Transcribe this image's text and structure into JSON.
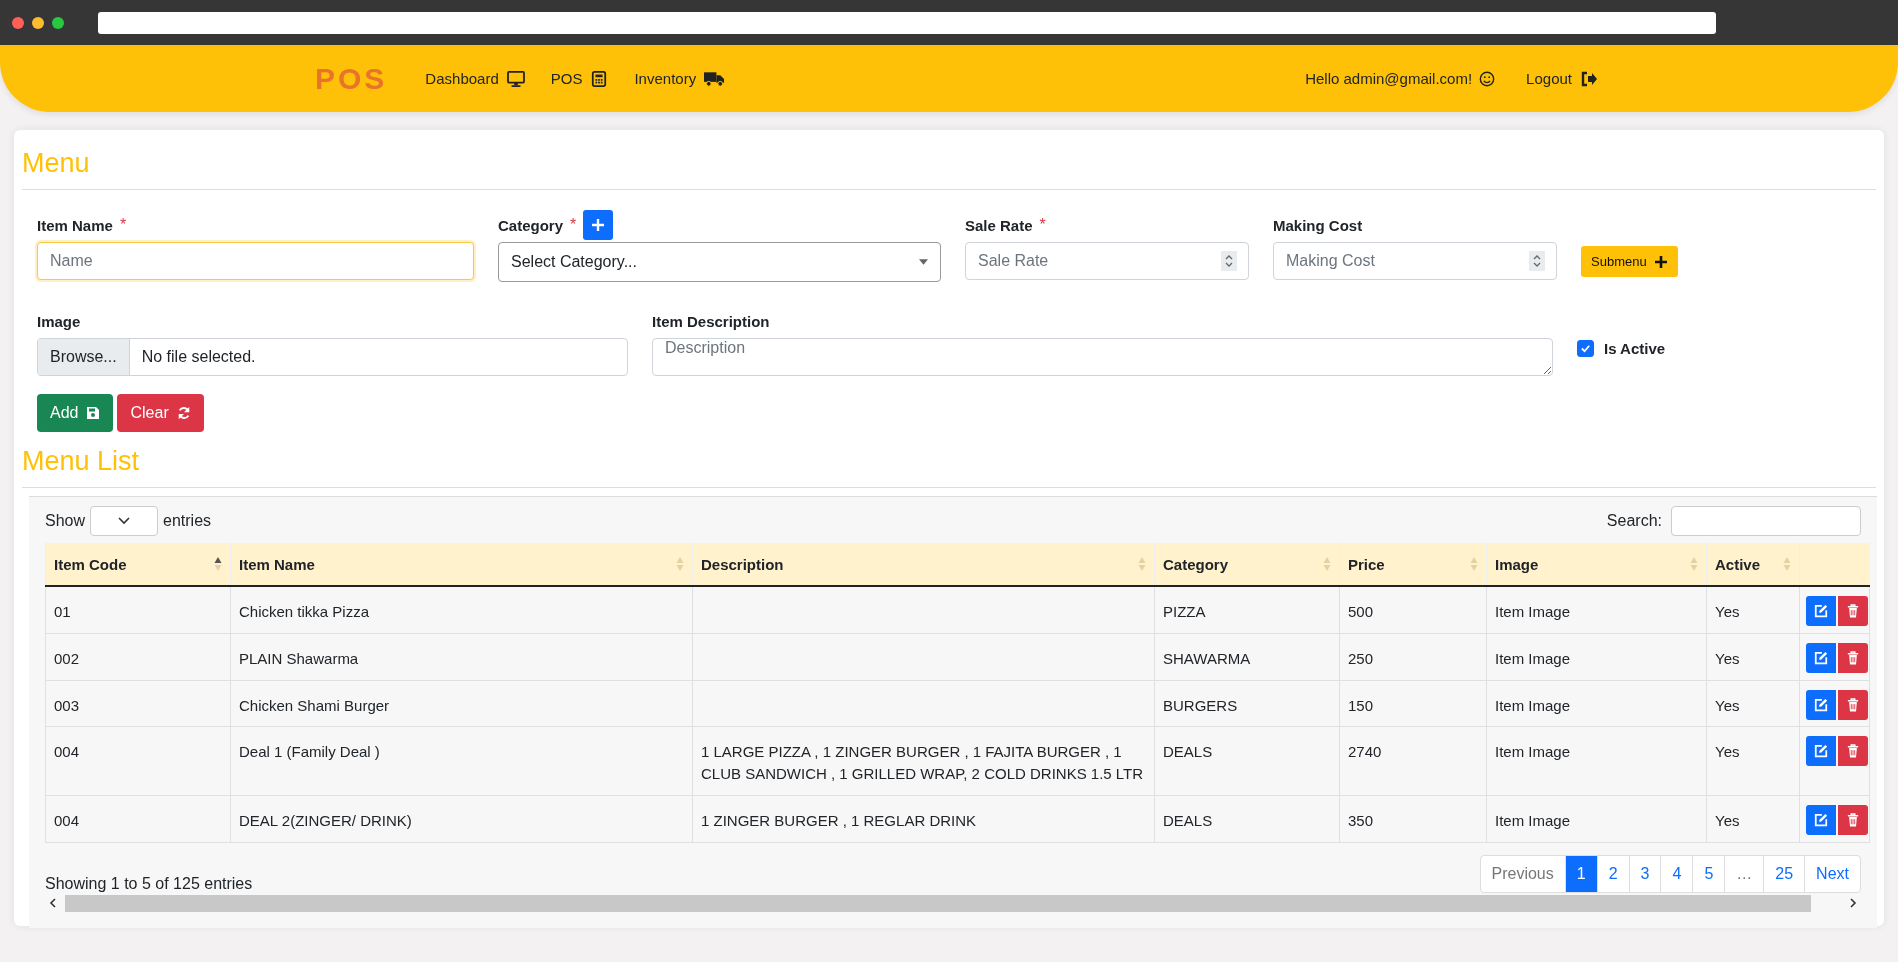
{
  "header": {
    "logo": "POS",
    "links": [
      {
        "label": "Dashboard"
      },
      {
        "label": "POS"
      },
      {
        "label": "Inventory"
      }
    ],
    "greeting": "Hello admin@gmail.com!",
    "logout": "Logout"
  },
  "form": {
    "title": "Menu",
    "rows": [
      {
        "fields": [
          {
            "kind": "text",
            "label": "Item Name",
            "required_mark": "*",
            "placeholder": "Name",
            "focused": true
          },
          {
            "kind": "select",
            "label": "Category",
            "required_mark": "*",
            "value": "Select Category...",
            "add_button": true
          },
          {
            "kind": "number",
            "label": "Sale Rate",
            "required_mark": "*",
            "placeholder": "Sale Rate"
          },
          {
            "kind": "number",
            "label": "Making Cost",
            "placeholder": "Making Cost"
          },
          {
            "kind": "button",
            "label": "Submenu"
          }
        ]
      },
      {
        "fields": [
          {
            "kind": "file",
            "label": "Image",
            "button": "Browse...",
            "value": "No file selected."
          },
          {
            "kind": "textarea",
            "label": "Item Description",
            "placeholder": "Description"
          },
          {
            "kind": "checkbox",
            "label": "Is Active",
            "checked": true
          }
        ]
      }
    ],
    "buttons": [
      {
        "label": "Add",
        "kind": "success"
      },
      {
        "label": "Clear",
        "kind": "danger"
      }
    ]
  },
  "list": {
    "title": "Menu List",
    "show_label": "Show",
    "entries_label": "entries",
    "search_label": "Search:",
    "columns": [
      {
        "label": "Item Code",
        "sorted": true
      },
      {
        "label": "Item Name",
        "sorted": false
      },
      {
        "label": "Description",
        "sorted": false
      },
      {
        "label": "Category",
        "sorted": false
      },
      {
        "label": "Price",
        "sorted": false
      },
      {
        "label": "Image",
        "sorted": false
      },
      {
        "label": "Active",
        "sorted": false
      }
    ],
    "rows": [
      {
        "cells": [
          "01",
          "Chicken tikka Pizza",
          null,
          "PIZZA",
          "500",
          "Item Image",
          "Yes"
        ]
      },
      {
        "cells": [
          "002",
          "PLAIN Shawarma",
          null,
          "SHAWARMA",
          "250",
          "Item Image",
          "Yes"
        ]
      },
      {
        "cells": [
          "003",
          "Chicken Shami Burger",
          null,
          "BURGERS",
          "150",
          "Item Image",
          "Yes"
        ]
      },
      {
        "cells": [
          "004",
          "Deal 1 (Family Deal )",
          "1 LARGE PIZZA , 1 ZINGER BURGER , 1 FAJITA BURGER , 1 CLUB SANDWICH , 1 GRILLED WRAP, 2 COLD DRINKS 1.5 LTR",
          "DEALS",
          "2740",
          "Item Image",
          "Yes"
        ]
      },
      {
        "cells": [
          "004",
          "DEAL 2(ZINGER/ DRINK)",
          "1 ZINGER BURGER , 1 REGLAR DRINK",
          "DEALS",
          "350",
          "Item Image",
          "Yes"
        ]
      }
    ],
    "info": "Showing 1 to 5 of 125 entries",
    "pages": [
      {
        "label": "Previous",
        "selected": false,
        "disabled": true
      },
      {
        "label": "1",
        "selected": true,
        "disabled": false
      },
      {
        "label": "2",
        "selected": false,
        "disabled": false
      },
      {
        "label": "3",
        "selected": false,
        "disabled": false
      },
      {
        "label": "4",
        "selected": false,
        "disabled": false
      },
      {
        "label": "5",
        "selected": false,
        "disabled": false
      },
      {
        "label": "…",
        "selected": false,
        "disabled": true
      },
      {
        "label": "25",
        "selected": false,
        "disabled": false
      },
      {
        "label": "Next",
        "selected": false,
        "disabled": false
      }
    ]
  }
}
